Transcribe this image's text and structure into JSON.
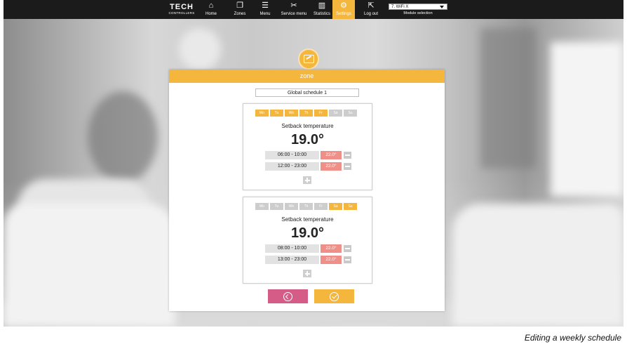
{
  "logo": {
    "line1": "TECH",
    "line2": "CONTROLLERS"
  },
  "nav": [
    {
      "label": "Home",
      "icon": "home-icon",
      "glyph": "⌂"
    },
    {
      "label": "Zones",
      "icon": "zones-icon",
      "glyph": "❐"
    },
    {
      "label": "Menu",
      "icon": "menu-icon",
      "glyph": "☰"
    },
    {
      "label": "Service menu",
      "icon": "service-icon",
      "glyph": "✂"
    },
    {
      "label": "Statistics",
      "icon": "statistics-icon",
      "glyph": "▥"
    },
    {
      "label": "Settings",
      "icon": "settings-icon",
      "glyph": "⚙"
    },
    {
      "label": "Log out",
      "icon": "logout-icon",
      "glyph": "⇱"
    }
  ],
  "module": {
    "selected": "7. WiFi X",
    "label": "Module selection"
  },
  "dialog": {
    "header": "zone",
    "schedule_name": "Global schedule 1",
    "schedules": [
      {
        "days": [
          {
            "label": "Mo",
            "active": true
          },
          {
            "label": "Tu",
            "active": true
          },
          {
            "label": "We",
            "active": true
          },
          {
            "label": "Th",
            "active": true
          },
          {
            "label": "Fr",
            "active": true
          },
          {
            "label": "Sa",
            "active": false
          },
          {
            "label": "Su",
            "active": false
          }
        ],
        "setback_title": "Setback temperature",
        "setback_value": "19.0°",
        "periods": [
          {
            "time": "06:00  -  10:00",
            "temp": "22.0°"
          },
          {
            "time": "12:00  -  23:00",
            "temp": "22.0°"
          }
        ]
      },
      {
        "days": [
          {
            "label": "Mo",
            "active": false
          },
          {
            "label": "Tu",
            "active": false
          },
          {
            "label": "We",
            "active": false
          },
          {
            "label": "Th",
            "active": false
          },
          {
            "label": "Fr",
            "active": false
          },
          {
            "label": "Sa",
            "active": true
          },
          {
            "label": "Su",
            "active": true
          }
        ],
        "setback_title": "Setback temperature",
        "setback_value": "19.0°",
        "periods": [
          {
            "time": "08:00  -  10:00",
            "temp": "22.0°"
          },
          {
            "time": "13:00  -  23:00",
            "temp": "22.0°"
          }
        ]
      }
    ]
  },
  "caption": "Editing a weekly schedule",
  "colors": {
    "accent": "#f4b63c",
    "back": "#d55c86",
    "temp": "#f08f87",
    "nav_bg": "#1b1b1b"
  }
}
